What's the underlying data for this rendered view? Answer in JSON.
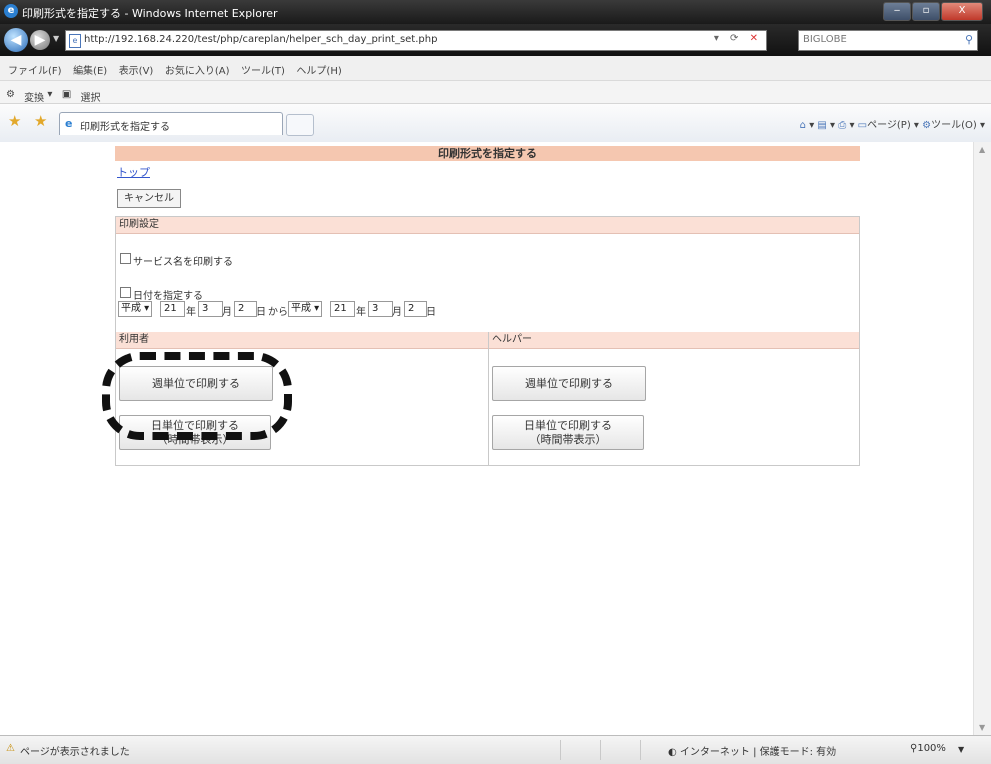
{
  "window": {
    "title": "印刷形式を指定する - Windows Internet Explorer",
    "ie_icon_glyph": "e",
    "buttons": {
      "minimize": "‒",
      "maximize": "▫",
      "close": "X"
    }
  },
  "address": {
    "url": "http://192.168.24.220/test/php/careplan/helper_sch_day_print_set.php",
    "search_placeholder": "BIGLOBE",
    "tool_glyphs": "▾ ⟳",
    "stop_glyph": "✕"
  },
  "menu": [
    "ファイル(F)",
    "編集(E)",
    "表示(V)",
    "お気に入り(A)",
    "ツール(T)",
    "ヘルプ(H)"
  ],
  "small_toolbar": {
    "convert": "変換",
    "select": "選択"
  },
  "tab": {
    "title": "印刷形式を指定する"
  },
  "command_bar": {
    "page": "ページ(P)",
    "tools": "ツール(O)"
  },
  "page": {
    "heading": "印刷形式を指定する",
    "top_link": "トップ",
    "cancel_label": "キャンセル",
    "print_settings": {
      "header": "印刷設定",
      "service_name_label": "サービス名を印刷する",
      "date_label": "日付を指定する",
      "from": {
        "era": "平成",
        "year": "21",
        "year_unit": "年",
        "month": "3",
        "month_unit": "月",
        "day": "2",
        "day_unit": "日"
      },
      "from_suffix": "から",
      "to": {
        "era": "平成",
        "year": "21",
        "year_unit": "年",
        "month": "3",
        "month_unit": "月",
        "day": "2",
        "day_unit": "日"
      }
    },
    "user_column": {
      "header": "利用者",
      "weekly_label": "週単位で印刷する",
      "daily_line1": "日単位で印刷する",
      "daily_line2": "（時間帯表示）"
    },
    "helper_column": {
      "header": "ヘルパー",
      "weekly_label": "週単位で印刷する",
      "daily_line1": "日単位で印刷する",
      "daily_line2": "（時間帯表示）"
    }
  },
  "status": {
    "text": "ページが表示されました",
    "zone": "インターネット | 保護モード: 有効",
    "zoom": "100%"
  },
  "colors": {
    "heading_bg": "#f5c7b0",
    "section_bg": "#fbe0d6",
    "link": "#3355cc"
  }
}
